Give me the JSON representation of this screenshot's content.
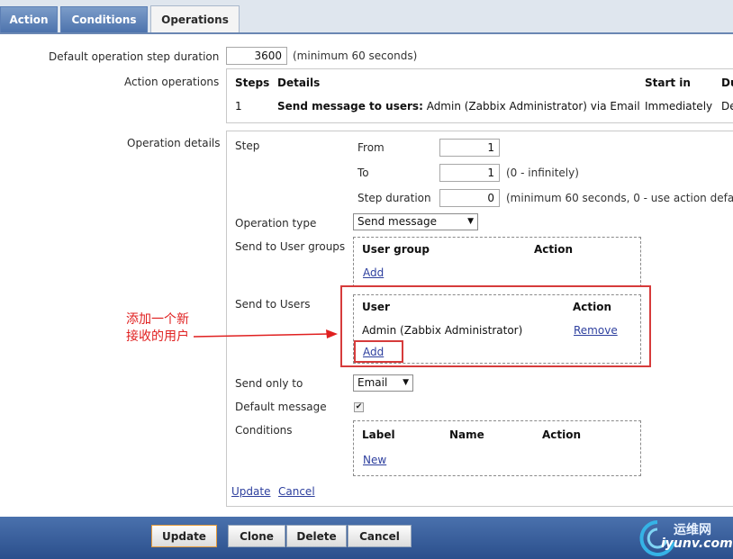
{
  "tabs": [
    {
      "label": "Action"
    },
    {
      "label": "Conditions"
    },
    {
      "label": "Operations"
    }
  ],
  "form": {
    "step_duration_label": "Default operation step duration",
    "step_duration_value": "3600",
    "step_duration_hint": "(minimum 60 seconds)",
    "action_operations_label": "Action operations",
    "ops_table": {
      "headers": [
        "Steps",
        "Details",
        "Start in",
        "Du"
      ],
      "row": {
        "step": "1",
        "details_bold": "Send message to users:",
        "details_rest": " Admin (Zabbix Administrator) via Email",
        "start_in": "Immediately",
        "duration": "De"
      }
    },
    "operation_details_label": "Operation details",
    "step_label": "Step",
    "from_label": "From",
    "from_value": "1",
    "to_label": "To",
    "to_value": "1",
    "to_hint": "(0 - infinitely)",
    "step_duration_label2": "Step duration",
    "step_duration_value2": "0",
    "step_duration_hint2": "(minimum 60 seconds, 0 - use action defa",
    "operation_type_label": "Operation type",
    "operation_type_value": "Send message",
    "send_to_groups_label": "Send to User groups",
    "groups_table": {
      "col_group": "User group",
      "col_action": "Action",
      "add": "Add"
    },
    "send_to_users_label": "Send to Users",
    "users_table": {
      "col_user": "User",
      "col_action": "Action",
      "user": "Admin (Zabbix Administrator)",
      "remove": "Remove",
      "add": "Add"
    },
    "send_only_to_label": "Send only to",
    "send_only_to_value": "Email",
    "default_message_label": "Default message",
    "default_message_check": "✔",
    "conditions_label": "Conditions",
    "conditions_table": {
      "col_label": "Label",
      "col_name": "Name",
      "col_action": "Action",
      "new": "New"
    },
    "update_link": "Update",
    "cancel_link": "Cancel"
  },
  "annotation": {
    "line1": "添加一个新",
    "line2": "接收的用户",
    "color": "#e02020"
  },
  "footer": {
    "update": "Update",
    "clone": "Clone",
    "delete": "Delete",
    "cancel": "Cancel"
  },
  "watermark": {
    "line1": "运维网",
    "line2": "iyunv.com"
  },
  "colors": {
    "tab_blue": "#4d73ad",
    "footer_blue": "#2b4f8c",
    "link": "#2d3f9e",
    "annotation_red": "#d63b3b"
  }
}
